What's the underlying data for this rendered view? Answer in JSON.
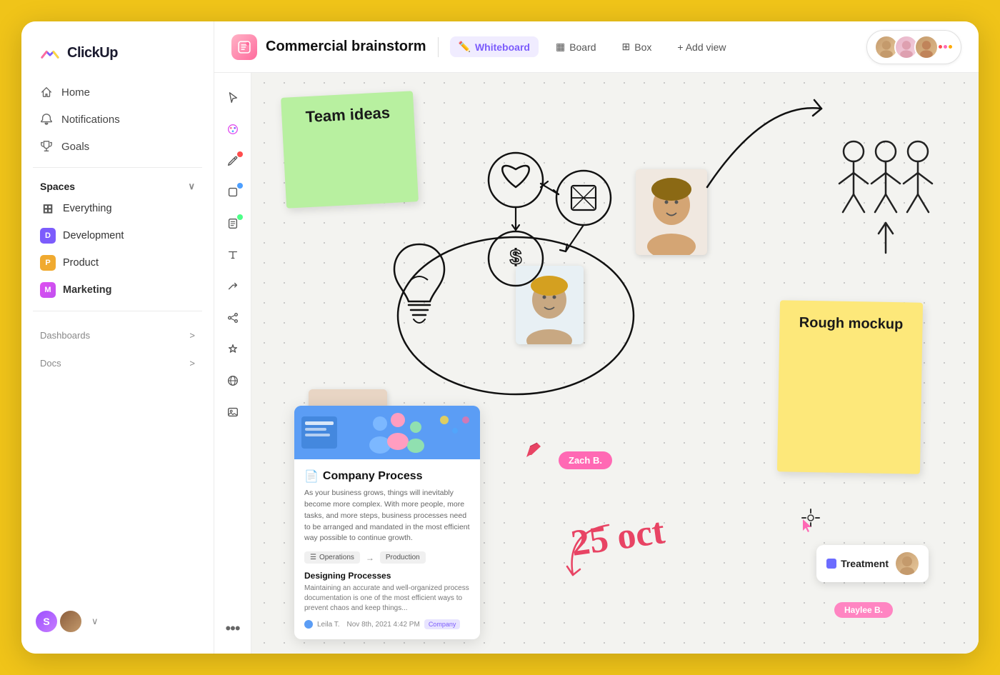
{
  "app": {
    "name": "ClickUp"
  },
  "sidebar": {
    "logo": "ClickUp",
    "nav": [
      {
        "id": "home",
        "label": "Home",
        "icon": "🏠"
      },
      {
        "id": "notifications",
        "label": "Notifications",
        "icon": "🔔"
      },
      {
        "id": "goals",
        "label": "Goals",
        "icon": "🏆"
      }
    ],
    "spaces_label": "Spaces",
    "spaces": [
      {
        "id": "everything",
        "label": "Everything",
        "color": null,
        "icon": "⊞"
      },
      {
        "id": "development",
        "label": "Development",
        "color": "#7c5cfc",
        "letter": "D"
      },
      {
        "id": "product",
        "label": "Product",
        "color": "#f0aa30",
        "letter": "P"
      },
      {
        "id": "marketing",
        "label": "Marketing",
        "color": "#e04ff0",
        "letter": "M",
        "bold": true
      }
    ],
    "sections": [
      {
        "id": "dashboards",
        "label": "Dashboards"
      },
      {
        "id": "docs",
        "label": "Docs"
      }
    ]
  },
  "topbar": {
    "page_icon": "📦",
    "page_title": "Commercial brainstorm",
    "views": [
      {
        "id": "whiteboard",
        "label": "Whiteboard",
        "icon": "✏️",
        "active": true
      },
      {
        "id": "board",
        "label": "Board",
        "icon": "▦"
      },
      {
        "id": "box",
        "label": "Box",
        "icon": "⊞"
      }
    ],
    "add_view_label": "+ Add view"
  },
  "whiteboard": {
    "sticky_green_text": "Team ideas",
    "sticky_yellow_text": "Rough mockup",
    "doc_title": "Company Process",
    "doc_text": "As your business grows, things will inevitably become more complex. With more people, more tasks, and more steps, business processes need to be arranged and mandated in the most efficient way possible to continue growth.",
    "doc_tag1": "Operations",
    "doc_tag2": "Production",
    "doc_subtitle": "Designing Processes",
    "doc_subtext": "Maintaining an accurate and well-organized process documentation is one of the most efficient ways to prevent chaos and keep things...",
    "doc_author": "Leila T.",
    "doc_date": "Nov 8th, 2021  4:42 PM",
    "doc_badge": "Company",
    "zach_label": "Zach B.",
    "haylee_label": "Haylee B.",
    "date_text": "25 oct",
    "treatment_label": "Treatment"
  },
  "tools": [
    {
      "id": "cursor",
      "icon": "↖"
    },
    {
      "id": "palette",
      "icon": "✦"
    },
    {
      "id": "pen",
      "icon": "✏",
      "dot": "red"
    },
    {
      "id": "square",
      "icon": "□",
      "dot": "blue"
    },
    {
      "id": "note",
      "icon": "◨",
      "dot": "green"
    },
    {
      "id": "text",
      "icon": "T"
    },
    {
      "id": "connector",
      "icon": "↗"
    },
    {
      "id": "share",
      "icon": "⑃"
    },
    {
      "id": "star",
      "icon": "✳"
    },
    {
      "id": "globe",
      "icon": "○"
    },
    {
      "id": "image",
      "icon": "⊡"
    },
    {
      "id": "more",
      "icon": "•••"
    }
  ]
}
